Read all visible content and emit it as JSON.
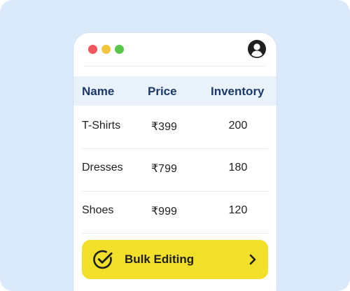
{
  "window": {
    "controls": [
      "red-dot",
      "yellow-dot",
      "green-dot"
    ],
    "user_icon": "user-circle-icon"
  },
  "table": {
    "headers": {
      "name": "Name",
      "price": "Price",
      "inventory": "Inventory"
    },
    "rows": [
      {
        "name": "T-Shirts",
        "price": "₹399",
        "inventory": "200"
      },
      {
        "name": "Dresses",
        "price": "₹799",
        "inventory": "180"
      },
      {
        "name": "Shoes",
        "price": "₹999",
        "inventory": "120"
      }
    ]
  },
  "bulk_action": {
    "label": "Bulk Editing",
    "icon": "check-circle-icon",
    "trailing_icon": "chevron-right-icon"
  },
  "colors": {
    "background": "#dbeafb",
    "header_bg": "#e9f1fb",
    "header_text": "#1b3a69",
    "button": "#f2df2a",
    "dot_red": "#f0565b",
    "dot_yellow": "#f2c53c",
    "dot_green": "#57c84a"
  }
}
